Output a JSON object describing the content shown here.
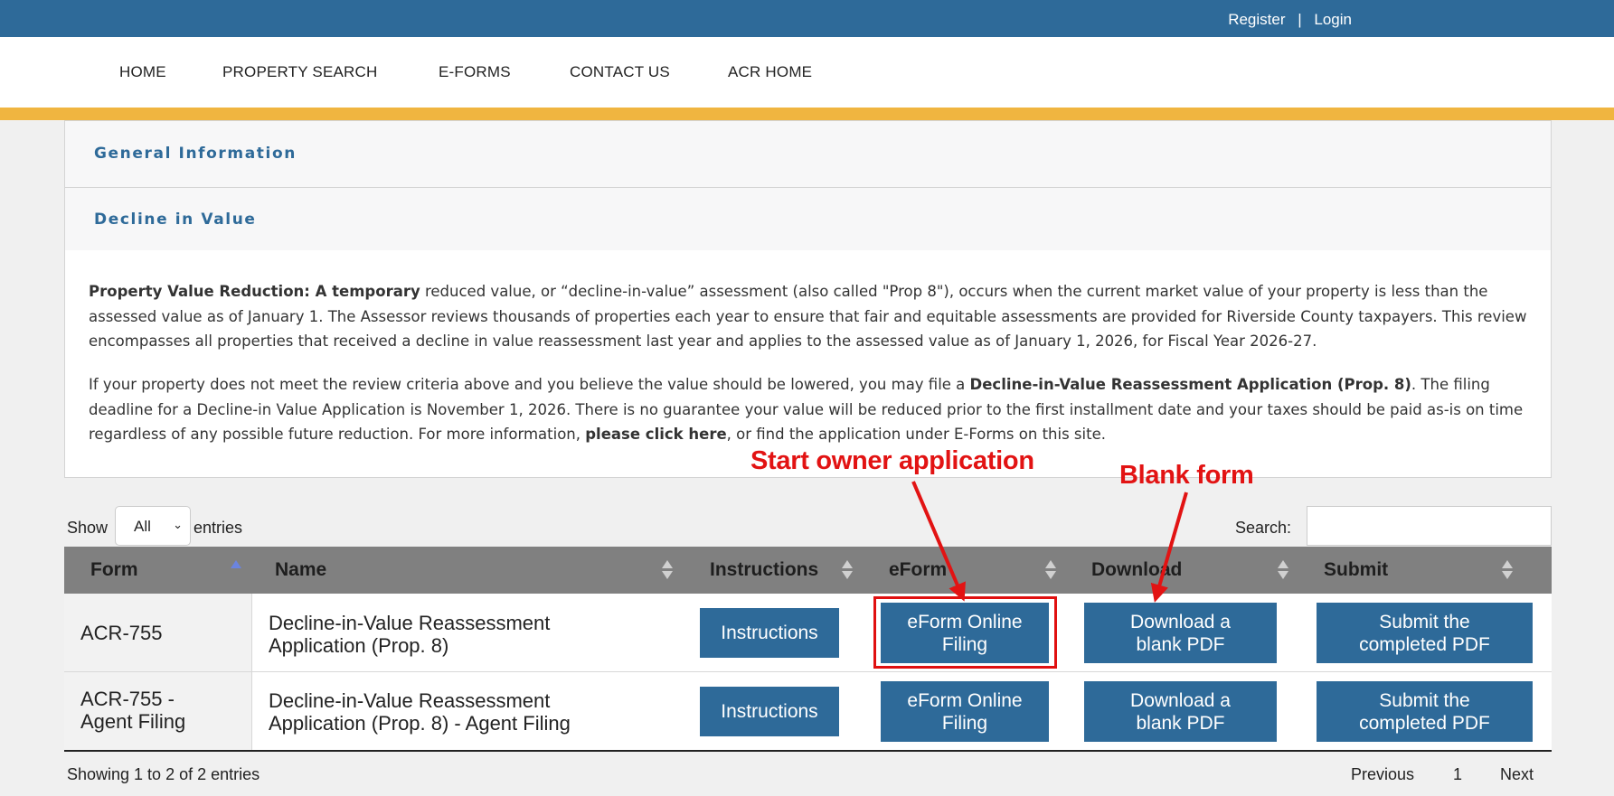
{
  "auth": {
    "register": "Register",
    "separator": "|",
    "login": "Login"
  },
  "nav": [
    "HOME",
    "PROPERTY SEARCH",
    "E-FORMS",
    "CONTACT US",
    "ACR HOME"
  ],
  "accordion": {
    "general": "General Information",
    "decline": "Decline in Value"
  },
  "content": {
    "p1_bold": "Property Value Reduction: A temporary",
    "p1_text": " reduced value, or “decline-in-value” assessment (also called \"Prop 8\"), occurs when the current market value of your property is less than the assessed value as of January 1. The Assessor reviews thousands of properties each year to ensure that fair and equitable assessments are provided for Riverside County taxpayers. This review encompasses all properties that received a decline in value reassessment last year and applies to the assessed value as of January 1, 2026, for Fiscal Year 2026-27.",
    "p2_text1": "If your property does not meet the review criteria above and you believe the value should be lowered, you may file a ",
    "p2_bold1": "Decline-in-Value Reassessment Application (Prop. 8)",
    "p2_text2": ". The filing deadline for a Decline-in Value Application is November 1, 2026. There is no guarantee your value will be reduced prior to the first installment date and your taxes should be paid as-is on time regardless of any possible future reduction. For more information, ",
    "p2_link": "please click here",
    "p2_text3": ", or find the application under E-Forms on this site."
  },
  "table_controls": {
    "show": "Show",
    "entries_value": "All",
    "entries": "entries",
    "search_label": "Search:",
    "search_value": ""
  },
  "table": {
    "columns": [
      "Form",
      "Name",
      "Instructions",
      "eForm",
      "Download",
      "Submit"
    ],
    "rows": [
      {
        "form": "ACR-755",
        "name": "Decline-in-Value Reassessment Application (Prop. 8)",
        "instructions": "Instructions",
        "eform": "eForm Online Filing",
        "download": "Download a blank PDF",
        "submit": "Submit the completed PDF"
      },
      {
        "form": "ACR-755 - Agent Filing",
        "name": "Decline-in-Value Reassessment Application (Prop. 8) - Agent Filing",
        "instructions": "Instructions",
        "eform": "eForm Online Filing",
        "download": "Download a blank PDF",
        "submit": "Submit the completed PDF"
      }
    ]
  },
  "footer": {
    "info": "Showing 1 to 2 of 2 entries",
    "previous": "Previous",
    "page": "1",
    "next": "Next"
  },
  "annotations": {
    "start_owner": "Start owner application",
    "blank_form": "Blank form"
  },
  "colors": {
    "brand_blue": "#2e6a99",
    "accent_gold": "#f0b540",
    "annotation_red": "#e21313",
    "header_gray": "#808080"
  }
}
